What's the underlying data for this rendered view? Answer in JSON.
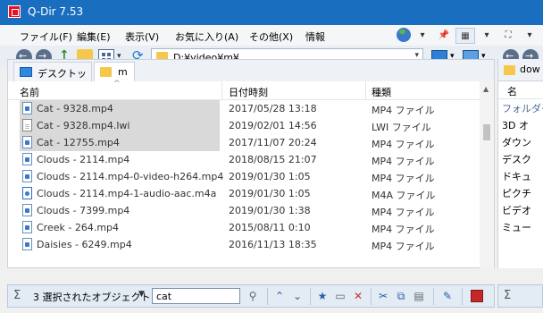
{
  "window": {
    "title": "Q-Dir 7.53"
  },
  "menu": {
    "items": [
      "ファイル(F)",
      "編集(E)",
      "表示(V)",
      "お気に入り(A)",
      "その他(X)",
      "情報"
    ]
  },
  "toolbar": {
    "address": "D:¥video¥m¥"
  },
  "left_pane": {
    "tabs": [
      {
        "label": "デスクトップ",
        "icon": "desktop-icon"
      },
      {
        "label": "m",
        "icon": "folder-icon"
      }
    ],
    "columns": [
      "名前",
      "日付時刻",
      "種類"
    ],
    "rows": [
      {
        "name": "Cat - 9328.mp4",
        "date": "2017/05/28 13:18",
        "type": "MP4 ファイル",
        "icon": "video-file-icon",
        "selected": true
      },
      {
        "name": "Cat - 9328.mp4.lwi",
        "date": "2019/02/01 14:56",
        "type": "LWI ファイル",
        "icon": "text-file-icon",
        "selected": true
      },
      {
        "name": "Cat - 12755.mp4",
        "date": "2017/11/07 20:24",
        "type": "MP4 ファイル",
        "icon": "video-file-icon",
        "selected": true
      },
      {
        "name": "Clouds - 2114.mp4",
        "date": "2018/08/15 21:07",
        "type": "MP4 ファイル",
        "icon": "video-file-icon",
        "selected": false
      },
      {
        "name": "Clouds - 2114.mp4-0-video-h264.mp4",
        "date": "2019/01/30 1:05",
        "type": "MP4 ファイル",
        "icon": "video-file-icon",
        "selected": false
      },
      {
        "name": "Clouds - 2114.mp4-1-audio-aac.m4a",
        "date": "2019/01/30 1:05",
        "type": "M4A ファイル",
        "icon": "audio-file-icon",
        "selected": false
      },
      {
        "name": "Clouds - 7399.mp4",
        "date": "2019/01/30 1:38",
        "type": "MP4 ファイル",
        "icon": "video-file-icon",
        "selected": false
      },
      {
        "name": "Creek - 264.mp4",
        "date": "2015/08/11 0:10",
        "type": "MP4 ファイル",
        "icon": "video-file-icon",
        "selected": false
      },
      {
        "name": "Daisies - 6249.mp4",
        "date": "2016/11/13 18:35",
        "type": "MP4 ファイル",
        "icon": "video-file-icon",
        "selected": false
      }
    ]
  },
  "right_pane": {
    "tab_label": "dow",
    "column": "名",
    "items": [
      "フォルダー",
      "3D オ",
      "ダウン",
      "デスク",
      "ドキュ",
      "ピクチ",
      "ビデオ",
      "ミュー"
    ]
  },
  "status": {
    "selection": "3 選択されたオブジェクト",
    "filter_value": "cat"
  },
  "colors": {
    "titlebar": "#1a6ec0",
    "selection": "#d9d9d9",
    "accent": "#2a5ea8"
  }
}
